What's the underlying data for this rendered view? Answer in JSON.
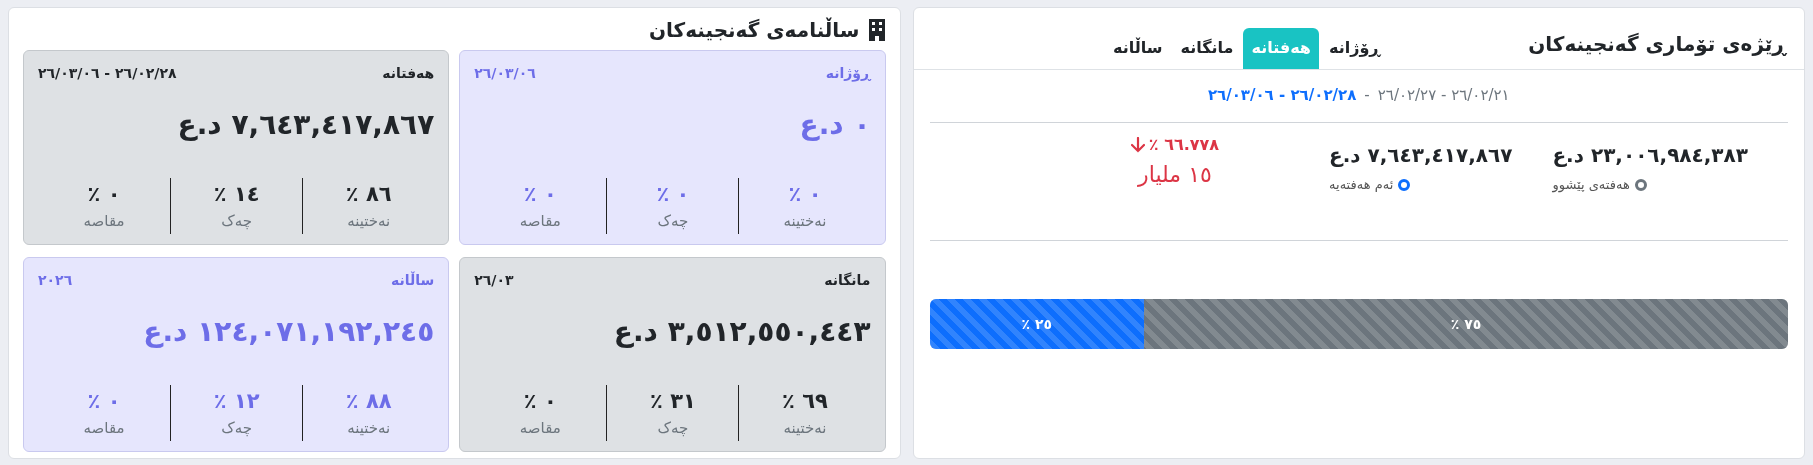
{
  "record_panel": {
    "title": "ڕێژەی تۆماری گەنجینەکان",
    "tabs": [
      {
        "label": "ڕۆژانە",
        "selected": false
      },
      {
        "label": "هەفتانە",
        "selected": true
      },
      {
        "label": "مانگانە",
        "selected": false
      },
      {
        "label": "ساڵانە",
        "selected": false
      }
    ],
    "date_ranges": [
      {
        "text": "٢٦/٠٢/٢١ - ٢٦/٠٢/٢٧",
        "selected": false
      },
      {
        "text": "٢٦/٠٢/٢٨ - ٢٦/٠٣/٠٦",
        "selected": true
      }
    ],
    "date_separator": "-",
    "stats": [
      {
        "amount": "٢٣,٠٠٦,٩٨٤,٣٨٣ د.ع",
        "label": "هەفتەی پێشوو",
        "color": "#6c757d"
      },
      {
        "amount": "٧,٦٤٣,٤١٧,٨٦٧ د.ع",
        "label": "ئەم هەفتەیە",
        "color": "#0d6efd"
      }
    ],
    "change": {
      "percent": "٦٦.٧٧٨ ٪",
      "down": true,
      "amount": "١٥ ملیار"
    },
    "progress": [
      {
        "label": "٧٥ ٪",
        "level": 0.75,
        "color": "#6c757d"
      },
      {
        "label": "٢٥ ٪",
        "level": 0.25,
        "color": "#0d6efd"
      }
    ]
  },
  "calendar_panel": {
    "title": "ساڵنامەی گەنجینەکان",
    "cards": [
      {
        "kind": "accent",
        "title": "ڕۆژانە",
        "date": "٢٦/٠٣/٠٦",
        "amount": "٠ د.ع",
        "stats": [
          {
            "value": "٠ ٪",
            "label": "نەختینە"
          },
          {
            "value": "٠ ٪",
            "label": "چەک"
          },
          {
            "value": "٠ ٪",
            "label": "مقاصە"
          }
        ]
      },
      {
        "kind": "plain",
        "title": "هەفتانە",
        "date": "٢٦/٠٢/٢٨ - ٢٦/٠٣/٠٦",
        "amount": "٧,٦٤٣,٤١٧,٨٦٧ د.ع",
        "stats": [
          {
            "value": "٨٦ ٪",
            "label": "نەختینە"
          },
          {
            "value": "١٤ ٪",
            "label": "چەک"
          },
          {
            "value": "٠ ٪",
            "label": "مقاصە"
          }
        ]
      },
      {
        "kind": "plain",
        "title": "مانگانە",
        "date": "٢٦/٠٣",
        "amount": "٣,٥١٢,٥٥٠,٤٤٣ د.ع",
        "stats": [
          {
            "value": "٦٩ ٪",
            "label": "نەختینە"
          },
          {
            "value": "٣١ ٪",
            "label": "چەک"
          },
          {
            "value": "٠ ٪",
            "label": "مقاصە"
          }
        ]
      },
      {
        "kind": "accent",
        "title": "ساڵانە",
        "date": "٢٠٢٦",
        "amount": "١٢٤,٠٧١,١٩٢,٢٤٥ د.ع",
        "stats": [
          {
            "value": "٨٨ ٪",
            "label": "نەختینە"
          },
          {
            "value": "١٢ ٪",
            "label": "چەک"
          },
          {
            "value": "٠ ٪",
            "label": "مقاصە"
          }
        ]
      }
    ]
  }
}
